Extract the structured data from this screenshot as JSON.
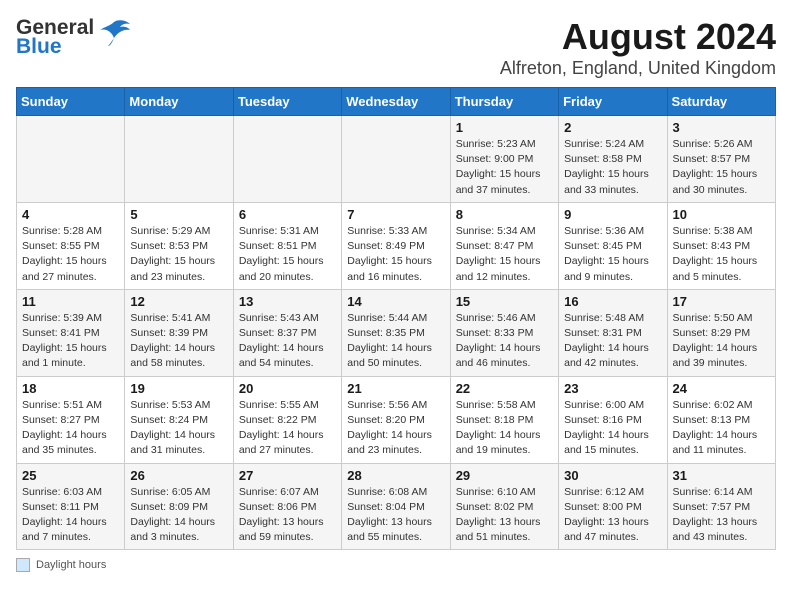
{
  "header": {
    "title": "August 2024",
    "subtitle": "Alfreton, England, United Kingdom",
    "logo_general": "General",
    "logo_blue": "Blue"
  },
  "days_of_week": [
    "Sunday",
    "Monday",
    "Tuesday",
    "Wednesday",
    "Thursday",
    "Friday",
    "Saturday"
  ],
  "weeks": [
    [
      {
        "date": "",
        "info": ""
      },
      {
        "date": "",
        "info": ""
      },
      {
        "date": "",
        "info": ""
      },
      {
        "date": "",
        "info": ""
      },
      {
        "date": "1",
        "info": "Sunrise: 5:23 AM\nSunset: 9:00 PM\nDaylight: 15 hours and 37 minutes."
      },
      {
        "date": "2",
        "info": "Sunrise: 5:24 AM\nSunset: 8:58 PM\nDaylight: 15 hours and 33 minutes."
      },
      {
        "date": "3",
        "info": "Sunrise: 5:26 AM\nSunset: 8:57 PM\nDaylight: 15 hours and 30 minutes."
      }
    ],
    [
      {
        "date": "4",
        "info": "Sunrise: 5:28 AM\nSunset: 8:55 PM\nDaylight: 15 hours and 27 minutes."
      },
      {
        "date": "5",
        "info": "Sunrise: 5:29 AM\nSunset: 8:53 PM\nDaylight: 15 hours and 23 minutes."
      },
      {
        "date": "6",
        "info": "Sunrise: 5:31 AM\nSunset: 8:51 PM\nDaylight: 15 hours and 20 minutes."
      },
      {
        "date": "7",
        "info": "Sunrise: 5:33 AM\nSunset: 8:49 PM\nDaylight: 15 hours and 16 minutes."
      },
      {
        "date": "8",
        "info": "Sunrise: 5:34 AM\nSunset: 8:47 PM\nDaylight: 15 hours and 12 minutes."
      },
      {
        "date": "9",
        "info": "Sunrise: 5:36 AM\nSunset: 8:45 PM\nDaylight: 15 hours and 9 minutes."
      },
      {
        "date": "10",
        "info": "Sunrise: 5:38 AM\nSunset: 8:43 PM\nDaylight: 15 hours and 5 minutes."
      }
    ],
    [
      {
        "date": "11",
        "info": "Sunrise: 5:39 AM\nSunset: 8:41 PM\nDaylight: 15 hours and 1 minute."
      },
      {
        "date": "12",
        "info": "Sunrise: 5:41 AM\nSunset: 8:39 PM\nDaylight: 14 hours and 58 minutes."
      },
      {
        "date": "13",
        "info": "Sunrise: 5:43 AM\nSunset: 8:37 PM\nDaylight: 14 hours and 54 minutes."
      },
      {
        "date": "14",
        "info": "Sunrise: 5:44 AM\nSunset: 8:35 PM\nDaylight: 14 hours and 50 minutes."
      },
      {
        "date": "15",
        "info": "Sunrise: 5:46 AM\nSunset: 8:33 PM\nDaylight: 14 hours and 46 minutes."
      },
      {
        "date": "16",
        "info": "Sunrise: 5:48 AM\nSunset: 8:31 PM\nDaylight: 14 hours and 42 minutes."
      },
      {
        "date": "17",
        "info": "Sunrise: 5:50 AM\nSunset: 8:29 PM\nDaylight: 14 hours and 39 minutes."
      }
    ],
    [
      {
        "date": "18",
        "info": "Sunrise: 5:51 AM\nSunset: 8:27 PM\nDaylight: 14 hours and 35 minutes."
      },
      {
        "date": "19",
        "info": "Sunrise: 5:53 AM\nSunset: 8:24 PM\nDaylight: 14 hours and 31 minutes."
      },
      {
        "date": "20",
        "info": "Sunrise: 5:55 AM\nSunset: 8:22 PM\nDaylight: 14 hours and 27 minutes."
      },
      {
        "date": "21",
        "info": "Sunrise: 5:56 AM\nSunset: 8:20 PM\nDaylight: 14 hours and 23 minutes."
      },
      {
        "date": "22",
        "info": "Sunrise: 5:58 AM\nSunset: 8:18 PM\nDaylight: 14 hours and 19 minutes."
      },
      {
        "date": "23",
        "info": "Sunrise: 6:00 AM\nSunset: 8:16 PM\nDaylight: 14 hours and 15 minutes."
      },
      {
        "date": "24",
        "info": "Sunrise: 6:02 AM\nSunset: 8:13 PM\nDaylight: 14 hours and 11 minutes."
      }
    ],
    [
      {
        "date": "25",
        "info": "Sunrise: 6:03 AM\nSunset: 8:11 PM\nDaylight: 14 hours and 7 minutes."
      },
      {
        "date": "26",
        "info": "Sunrise: 6:05 AM\nSunset: 8:09 PM\nDaylight: 14 hours and 3 minutes."
      },
      {
        "date": "27",
        "info": "Sunrise: 6:07 AM\nSunset: 8:06 PM\nDaylight: 13 hours and 59 minutes."
      },
      {
        "date": "28",
        "info": "Sunrise: 6:08 AM\nSunset: 8:04 PM\nDaylight: 13 hours and 55 minutes."
      },
      {
        "date": "29",
        "info": "Sunrise: 6:10 AM\nSunset: 8:02 PM\nDaylight: 13 hours and 51 minutes."
      },
      {
        "date": "30",
        "info": "Sunrise: 6:12 AM\nSunset: 8:00 PM\nDaylight: 13 hours and 47 minutes."
      },
      {
        "date": "31",
        "info": "Sunrise: 6:14 AM\nSunset: 7:57 PM\nDaylight: 13 hours and 43 minutes."
      }
    ]
  ],
  "footer": {
    "box_label": "Daylight hours"
  }
}
